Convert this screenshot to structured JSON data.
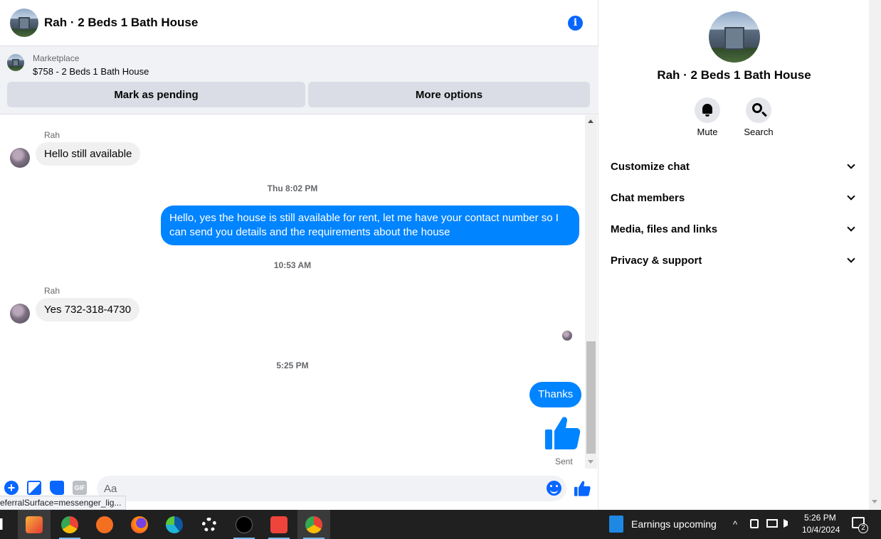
{
  "header": {
    "title": "Rah · 2 Beds 1 Bath House",
    "info_icon": "info-icon"
  },
  "marketplace": {
    "label": "Marketplace",
    "listing": "$758 - 2 Beds 1 Bath House",
    "mark_pending": "Mark as pending",
    "more_options": "More options"
  },
  "messages": {
    "first_sender": "Rah",
    "msg1": "Hello still available",
    "time1": "Thu 8:02 PM",
    "msg2": "Hello, yes the house is still available for rent, let me have your contact number so I can send you details and the requirements about the house",
    "time2": "10:53 AM",
    "second_sender": "Rah",
    "msg3": "Yes 732-318-4730",
    "time3": "5:25 PM",
    "msg4": "Thanks",
    "status": "Sent"
  },
  "composer": {
    "placeholder": "Aa",
    "gif_label": "GIF"
  },
  "status_url": "eferralSurface=messenger_lig...",
  "panel": {
    "name": "Rah · 2 Beds 1 Bath House",
    "mute": "Mute",
    "search": "Search",
    "sections": [
      "Customize chat",
      "Chat members",
      "Media, files and links",
      "Privacy & support"
    ]
  },
  "taskbar": {
    "weather": "Earnings upcoming",
    "time": "5:26 PM",
    "date": "10/4/2024",
    "notifications": "2"
  },
  "colors": {
    "accent": "#0866ff",
    "outgoing_bubble": "#0084ff",
    "incoming_bubble": "#f0f0f0"
  }
}
